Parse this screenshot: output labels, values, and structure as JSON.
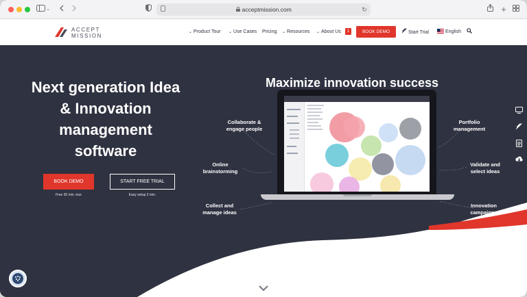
{
  "browser": {
    "url": "acceptmission.com"
  },
  "site": {
    "logo_line1": "ACCEPT",
    "logo_line2": "MISSION",
    "nav": [
      {
        "label": "Product Tour"
      },
      {
        "label": "Use Cases"
      },
      {
        "label": "Pricing"
      },
      {
        "label": "Resources"
      },
      {
        "label": "About Us"
      }
    ],
    "about_badge": "1",
    "book_demo": "BOOK DEMO",
    "start_trial": "Start Trial",
    "language": "English"
  },
  "hero": {
    "headline": "Next generation Idea & Innovation management software",
    "cta_primary": "BOOK DEMO",
    "cta_primary_caption": "Free 30 min. tour",
    "cta_secondary": "START FREE TRIAL",
    "cta_secondary_caption": "Easy setup 2 min.",
    "right_title": "Maximize innovation success",
    "features_left": [
      "Collaborate &\nengage people",
      "Online\nbrainstorming",
      "Collect and\nmanage ideas"
    ],
    "features_right": [
      "Portfolio\nmanagement",
      "Validate and\nselect ideas",
      "Innovation\ncampaigns"
    ]
  },
  "colors": {
    "brand_red": "#e0362b",
    "hero_bg": "#2f3240"
  },
  "icons": {
    "side": [
      "monitor-icon",
      "rocket-icon",
      "document-icon",
      "download-icon"
    ]
  }
}
